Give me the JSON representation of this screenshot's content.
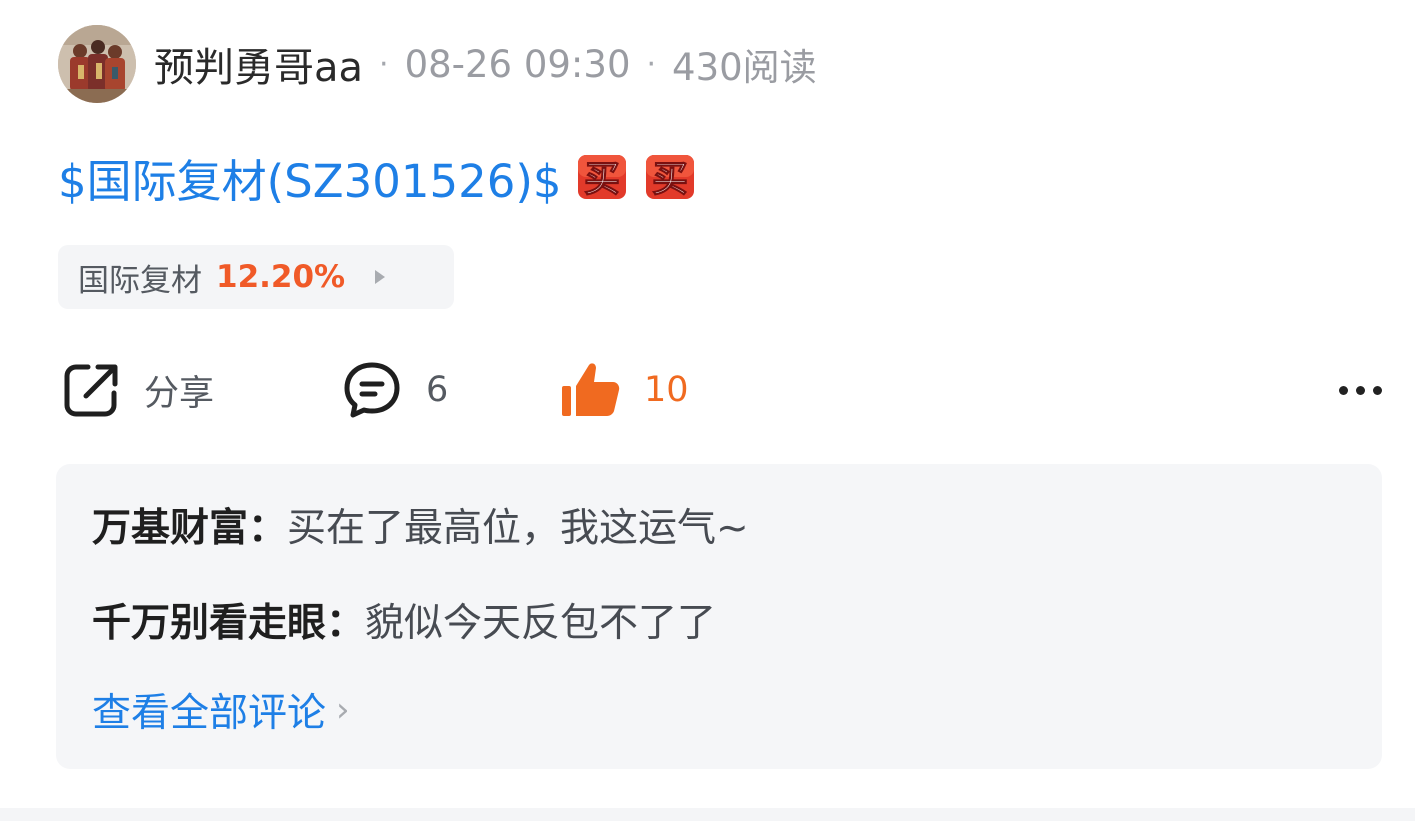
{
  "post": {
    "author": {
      "name": "预判勇哥aa"
    },
    "time": "08-26 09:30",
    "reads": "430阅读",
    "meta_separator": "·",
    "body": {
      "stock_link": "$国际复材(SZ301526)$",
      "emojis": [
        "买",
        "买"
      ]
    },
    "stock_chip": {
      "name": "国际复材",
      "change": "12.20%",
      "change_color": "#f05a28"
    }
  },
  "actions": {
    "share_label": "分享",
    "comment_count": "6",
    "like_count": "10",
    "like_color": "#f06a20",
    "icons": {
      "share": "share-icon",
      "comment": "comment-icon",
      "like": "thumbs-up-icon",
      "more": "more-icon"
    }
  },
  "comments": {
    "items": [
      {
        "author": "万基财富：",
        "text": "买在了最高位，我这运气~"
      },
      {
        "author": "千万别看走眼：",
        "text": "貌似今天反包不了了"
      }
    ],
    "view_all_label": "查看全部评论",
    "view_all_arrow": "›"
  },
  "colors": {
    "link": "#1e7fe6",
    "panel_bg": "#f5f6f8"
  }
}
